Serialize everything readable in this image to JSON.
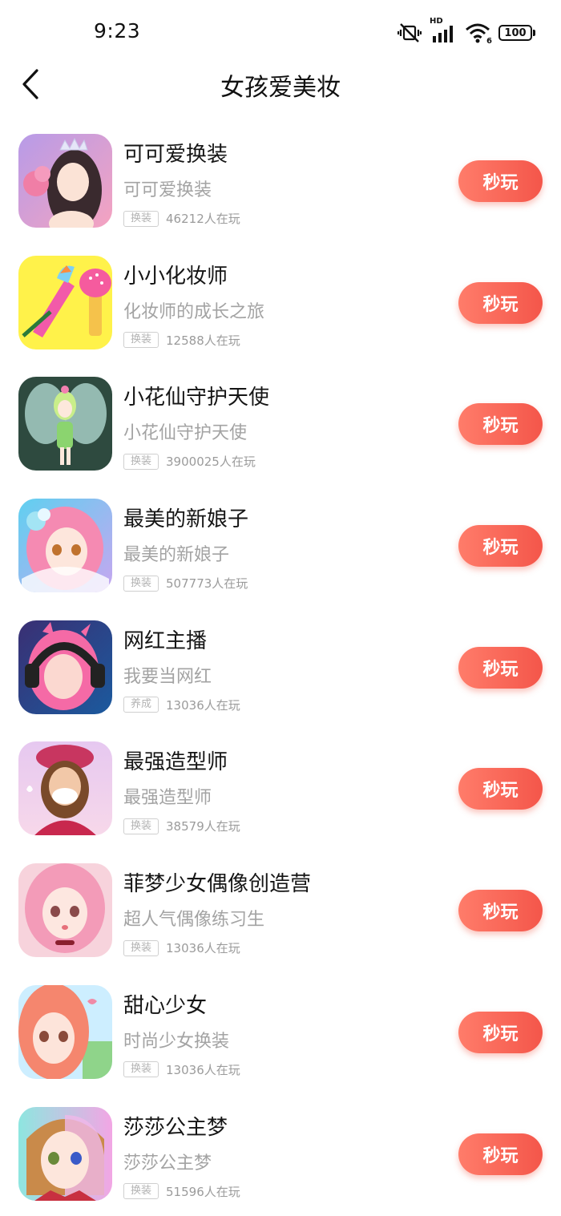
{
  "status": {
    "time": "9:23",
    "network_label": "HD",
    "wifi_label": "6",
    "battery": "100"
  },
  "nav": {
    "title": "女孩爱美妆"
  },
  "play_label": "秒玩",
  "colors": {
    "play_button": "#f4564a",
    "desc_text": "#a3a3a3"
  },
  "games": [
    {
      "name": "可可爱换装",
      "desc": "可可爱换装",
      "tag": "换装",
      "players": "46212人在玩",
      "icon": "princess-dressup-icon"
    },
    {
      "name": "小小化妆师",
      "desc": "化妆师的成长之旅",
      "tag": "换装",
      "players": "12588人在玩",
      "icon": "lipstick-brush-icon"
    },
    {
      "name": "小花仙守护天使",
      "desc": "小花仙守护天使",
      "tag": "换装",
      "players": "3900025人在玩",
      "icon": "fairy-icon"
    },
    {
      "name": "最美的新娘子",
      "desc": "最美的新娘子",
      "tag": "换装",
      "players": "507773人在玩",
      "icon": "bride-icon"
    },
    {
      "name": "网红主播",
      "desc": "我要当网红",
      "tag": "养成",
      "players": "13036人在玩",
      "icon": "streamer-headphones-icon"
    },
    {
      "name": "最强造型师",
      "desc": "最强造型师",
      "tag": "换装",
      "players": "38579人在玩",
      "icon": "stylist-mask-icon"
    },
    {
      "name": "菲梦少女偶像创造营",
      "desc": "超人气偶像练习生",
      "tag": "换装",
      "players": "13036人在玩",
      "icon": "idol-girl-icon"
    },
    {
      "name": "甜心少女",
      "desc": "时尚少女换装",
      "tag": "换装",
      "players": "13036人在玩",
      "icon": "sweet-girl-icon"
    },
    {
      "name": "莎莎公主梦",
      "desc": "莎莎公主梦",
      "tag": "换装",
      "players": "51596人在玩",
      "icon": "princess-dream-icon"
    }
  ]
}
